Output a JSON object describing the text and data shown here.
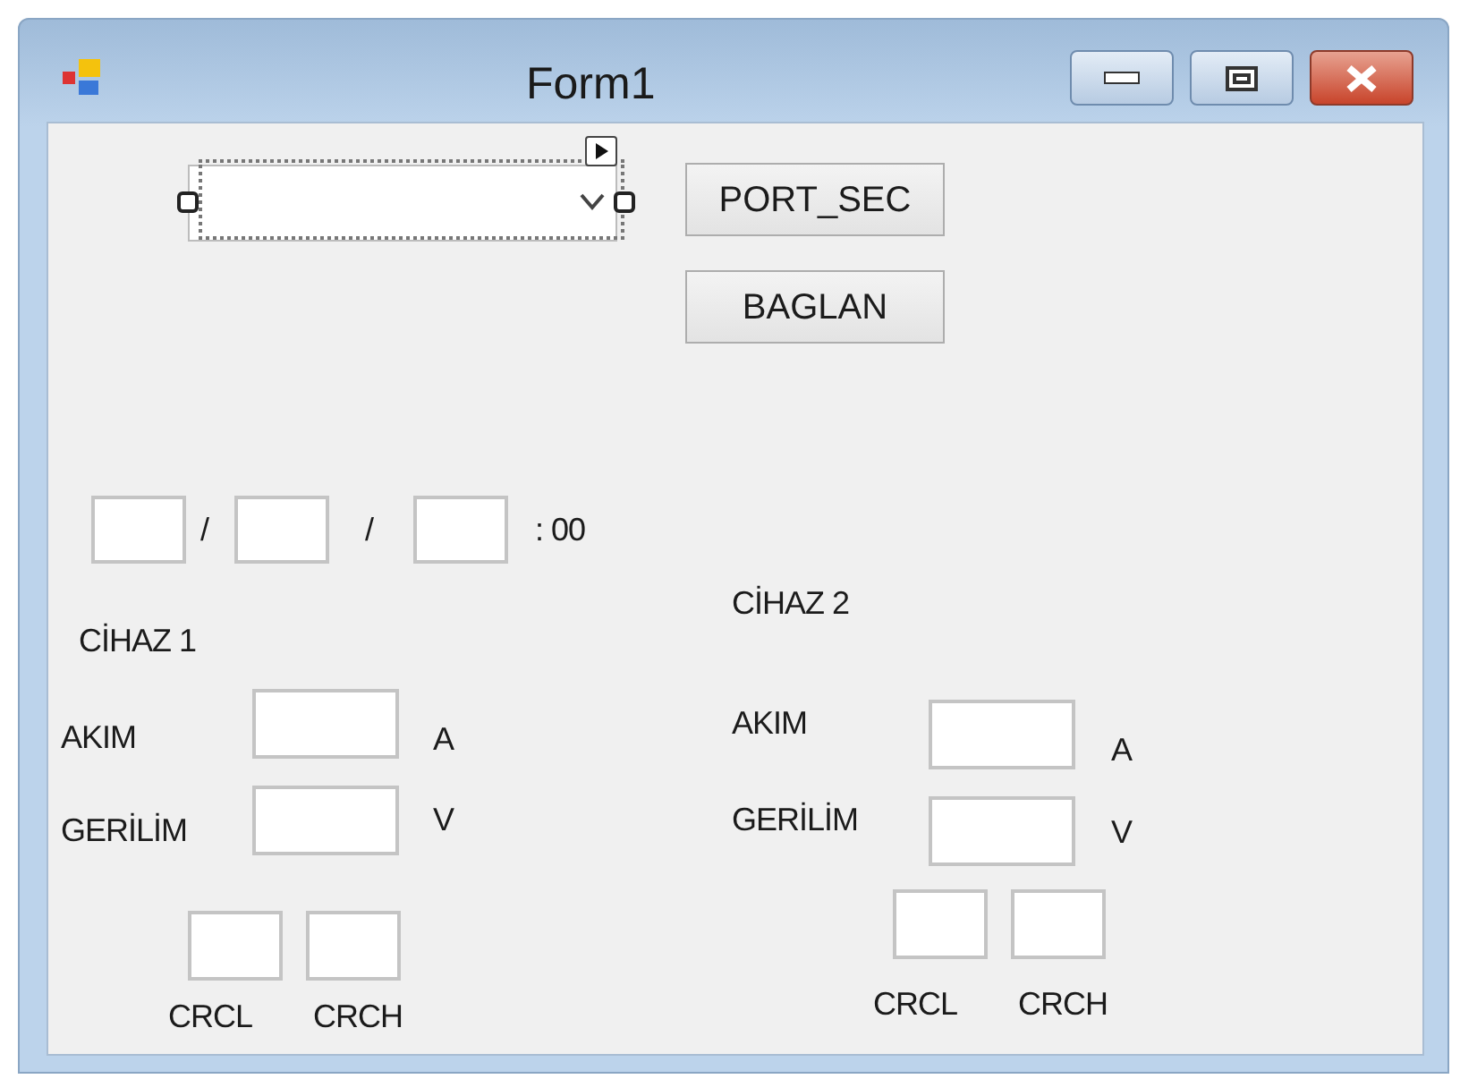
{
  "window": {
    "title": "Form1"
  },
  "combo": {
    "selected": true
  },
  "buttons": [
    "PORT_SEC",
    "BAGLAN"
  ],
  "date_row": {
    "separators": [
      "/",
      "/"
    ],
    "suffix": ": 00"
  },
  "devices": [
    {
      "title": "CİHAZ 1",
      "rows": [
        {
          "label": "AKIM",
          "unit": "A"
        },
        {
          "label": "GERİLİM",
          "unit": "V"
        }
      ],
      "crc_labels": [
        "CRCL",
        "CRCH"
      ]
    },
    {
      "title": "CİHAZ 2",
      "rows": [
        {
          "label": "AKIM",
          "unit": "A"
        },
        {
          "label": "GERİLİM",
          "unit": "V"
        }
      ],
      "crc_labels": [
        "CRCL",
        "CRCH"
      ]
    }
  ]
}
